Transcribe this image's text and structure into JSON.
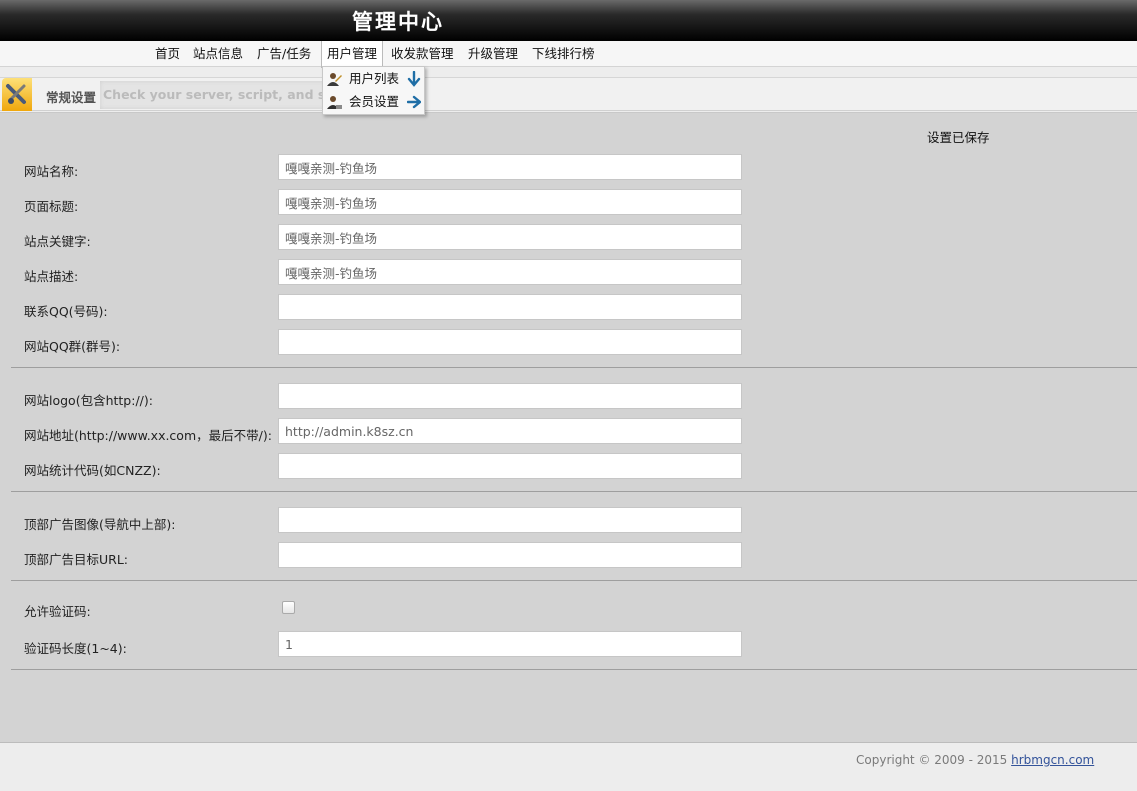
{
  "header": {
    "title": "管理中心"
  },
  "nav": {
    "items": [
      {
        "label": "首页"
      },
      {
        "label": "站点信息"
      },
      {
        "label": "广告/任务"
      },
      {
        "label": "用户管理"
      },
      {
        "label": "收发款管理"
      },
      {
        "label": "升级管理"
      },
      {
        "label": "下线排行榜"
      }
    ],
    "active_index": 3,
    "dropdown": [
      {
        "label": "用户列表",
        "icon": "user-edit-icon",
        "arrow": "arrow-down-icon"
      },
      {
        "label": "会员设置",
        "icon": "user-settings-icon",
        "arrow": "arrow-right-icon"
      }
    ]
  },
  "tab": {
    "icon": "settings-tools-icon",
    "label": "常规设置",
    "hint": "Check your server, script, and site details"
  },
  "status": {
    "saved": "设置已保存"
  },
  "form": {
    "site_name": {
      "label": "网站名称:",
      "value": "嘎嘎亲测-钓鱼场"
    },
    "page_title": {
      "label": "页面标题:",
      "value": "嘎嘎亲测-钓鱼场"
    },
    "keywords": {
      "label": "站点关键字:",
      "value": "嘎嘎亲测-钓鱼场"
    },
    "description": {
      "label": "站点描述:",
      "value": "嘎嘎亲测-钓鱼场"
    },
    "contact_qq": {
      "label": "联系QQ(号码):",
      "value": ""
    },
    "qq_group": {
      "label": "网站QQ群(群号):",
      "value": ""
    },
    "logo": {
      "label": "网站logo(包含http://):",
      "value": ""
    },
    "site_url": {
      "label": "网站地址(http://www.xx.com，最后不带/):",
      "value": "http://admin.k8sz.cn"
    },
    "stats_code": {
      "label": "网站统计代码(如CNZZ):",
      "value": ""
    },
    "top_ad_image": {
      "label": "顶部广告图像(导航中上部):",
      "value": ""
    },
    "top_ad_url": {
      "label": "顶部广告目标URL:",
      "value": ""
    },
    "captcha_enabled": {
      "label": "允许验证码:",
      "checked": false
    },
    "captcha_length": {
      "label": "验证码长度(1~4):",
      "value": "1"
    }
  },
  "footer": {
    "copyright": "Copyright © 2009 - 2015 ",
    "link": "hrbmgcn.com"
  },
  "colors": {
    "topbar": "#000000",
    "main_bg": "#d3d3d3",
    "arrow": "#1f6ea6",
    "link": "#33539a"
  }
}
